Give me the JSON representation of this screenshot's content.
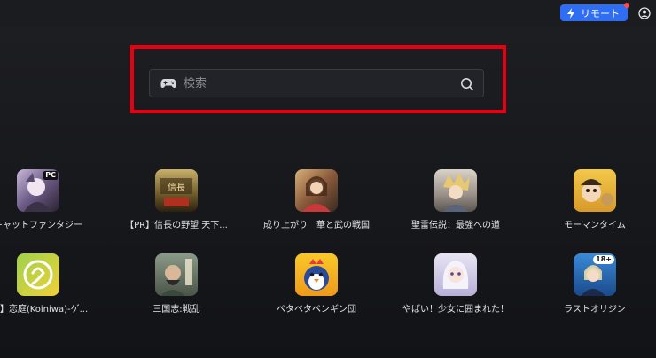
{
  "header": {
    "remote_label": "リモート"
  },
  "search": {
    "placeholder": "検索"
  },
  "apps_row1": [
    {
      "label": "キャットファンタジー",
      "badge": "PC"
    },
    {
      "label": "【PR】信長の野望 天下..."
    },
    {
      "label": "成り上がり　華と武の戦国"
    },
    {
      "label": "聖雷伝説：最強への道"
    },
    {
      "label": "モーマンタイム"
    }
  ],
  "apps_row2": [
    {
      "label": "PR】恋庭(Koiniwa)-ゲ..."
    },
    {
      "label": "三国志:戦乱"
    },
    {
      "label": "ペタペタペンギン団"
    },
    {
      "label": "やばい！少女に囲まれた！"
    },
    {
      "label": "ラストオリジン",
      "badge": "18+"
    }
  ],
  "colors": {
    "accent_blue": "#2f6df3",
    "highlight_red": "#e60012",
    "background": "#1b1c20"
  }
}
